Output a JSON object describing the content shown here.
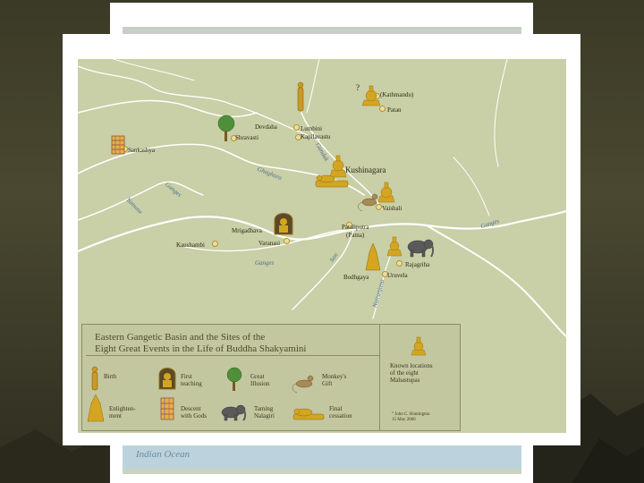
{
  "back_map": {
    "ocean_label": "Indian Ocean"
  },
  "map": {
    "places": {
      "kathmandu": "(Kathmandu)",
      "patan": "Patan",
      "devdaha": "Devdaha",
      "lumbini": "Lumbini",
      "kapilavastu": "Kapilavastu",
      "shravasti": "Shravasti",
      "sankashya": "Sankashya",
      "kushinagara": "Kushinagara",
      "vaishali": "Vaishali",
      "mrigadhava": "Mrigadhava",
      "varanasi": "Varanasi",
      "pataliputra": "Pataliputra",
      "patna": "(Patna)",
      "kaushambi": "Kaushambi",
      "rajagriha": "Rajagriha",
      "bodhgaya": "Bodhgaya",
      "uruvela": "Uruvela",
      "question": "?"
    },
    "rivers": {
      "ghaghara": "Ghaghara",
      "gandak": "Gandak",
      "ganges_1": "Ganges",
      "ganges_2": "Ganges",
      "ganges_3": "Ganges",
      "yamuna": "Yamuna",
      "son": "Son",
      "nairanjana": "Nairanjana"
    },
    "legend": {
      "title_line1": "Eastern Gangetic Basin and the Sites of the",
      "title_line2": "Eight Great Events in the Life of Buddha Shakyamini",
      "items": {
        "birth": "Birth",
        "first_teaching_1": "First",
        "first_teaching_2": "teaching",
        "great_illusion_1": "Great",
        "great_illusion_2": "Illusion",
        "monkey_1": "Monkey's",
        "monkey_2": "Gift",
        "enlight_1": "Enlighten-",
        "enlight_2": "ment",
        "descent_1": "Descent",
        "descent_2": "with Gods",
        "taming_1": "Taming",
        "taming_2": "Nalagiri",
        "final_1": "Final",
        "final_2": "cessation"
      },
      "known_1": "Known locations",
      "known_2": "of the eight",
      "known_3": "Mahastupas",
      "credit_1": "° John C. Huntington",
      "credit_2": "15 May 2000"
    }
  },
  "colors": {
    "background": "#3b3a26",
    "map_land": "#c9cfa6",
    "river": "#ffffff",
    "river_label": "#4a6e92",
    "stupa_gold": "#d4a520"
  }
}
